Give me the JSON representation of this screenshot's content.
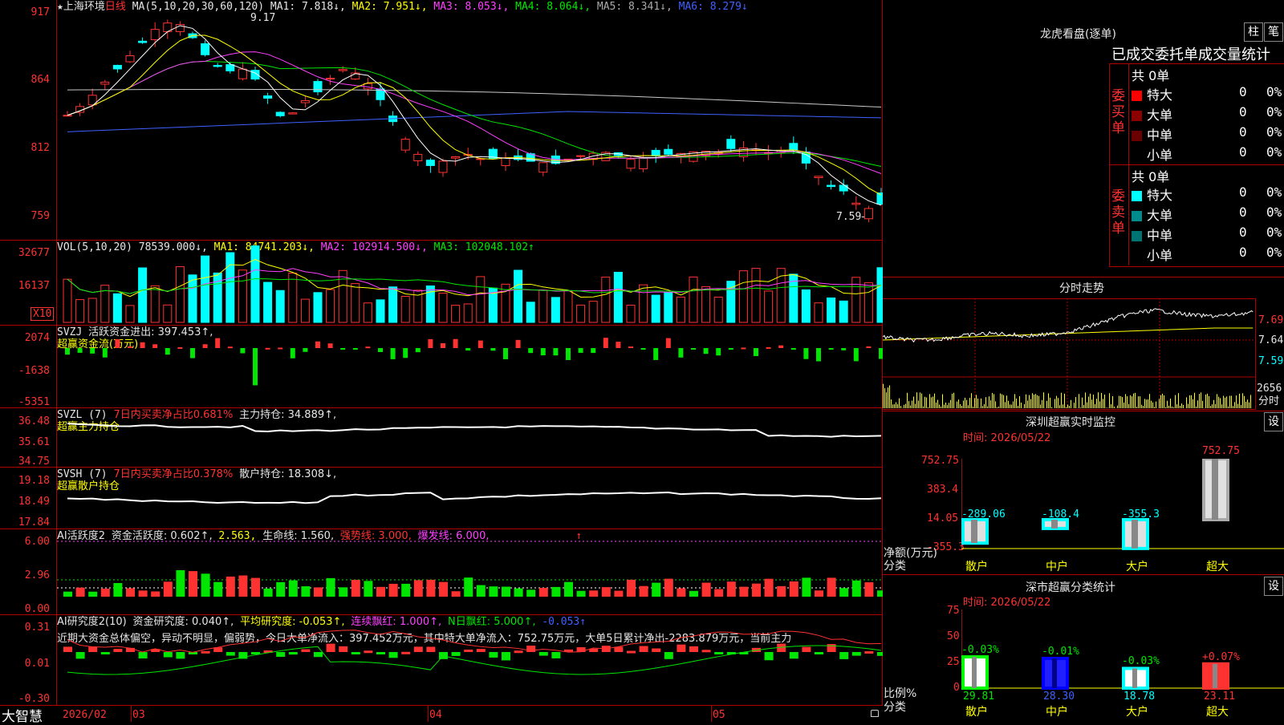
{
  "header": {
    "star": "★",
    "stock_name": "上海环境",
    "period": "日线",
    "ma_params": "MA(5,10,20,30,60,120)",
    "ma1": "MA1: 7.818↓,",
    "ma2": "MA2: 7.951↓,",
    "ma3": "MA3: 8.053↓,",
    "ma4": "MA4: 8.064↓,",
    "ma5": "MA5: 8.341↓,",
    "ma6": "MA6: 8.279↓"
  },
  "price_axis": [
    "917",
    "864",
    "812",
    "759"
  ],
  "price_marks": {
    "high": "9.17",
    "low": "7.59→"
  },
  "vol": {
    "label": "VOL(5,10,20)",
    "val": "78539.000↓,",
    "ma1": "MA1: 84741.203↓,",
    "ma2": "MA2: 102914.500↓,",
    "ma3": "MA3: 102048.102↑",
    "axis": [
      "32677",
      "16137"
    ],
    "unit": "X10"
  },
  "svzj": {
    "label": "SVZJ",
    "line1": "活跃资金进出: 397.453↑,",
    "line2": "超赢资金流(万元)",
    "axis": [
      "2074",
      "-1638",
      "-5351"
    ]
  },
  "svzl": {
    "label": "SVZL (7)",
    "txt1": "7日内买卖净占比0.681%",
    "txt2": "主力持仓: 34.889↑,",
    "line2": "超赢主力持仓",
    "axis": [
      "36.48",
      "35.61",
      "34.75"
    ]
  },
  "svsh": {
    "label": "SVSH (7)",
    "txt1": "7日内买卖净占比0.378%",
    "txt2": "散户持仓: 18.308↓,",
    "line2": "超赢散户持仓",
    "axis": [
      "19.18",
      "18.49",
      "17.84"
    ]
  },
  "ai1": {
    "label": "AI活跃度2",
    "t1": "资金活跃度: 0.602↑,",
    "t2": "2.563,",
    "t3": "生命线: 1.560,",
    "t4": "强势线: 3.000,",
    "t5": "爆发线: 6.000,",
    "t6": "↑",
    "axis": [
      "6.00",
      "2.96",
      "0.00"
    ]
  },
  "ai2": {
    "label": "AI研究度2(10)",
    "t1": "资金研究度: 0.040↑,",
    "t2": "平均研究度: -0.053↑,",
    "t3": "连续飘红: 1.000↑,",
    "t4": "N日飘红: 5.000↑,",
    "t5": "-0.053↑",
    "comment": "近期大资金总体偏空，异动不明显，偏弱势，今日大单净流入：397.452万元，其中特大单净流入：752.75万元，大单5日累计净出-2283.879万元，当前主力",
    "axis": [
      "0.31",
      "0.01",
      "-0.30"
    ]
  },
  "xaxis": {
    "brand": "大智慧",
    "labels": [
      "2026/02",
      "03",
      "04",
      "05"
    ]
  },
  "lhb": {
    "title": "龙虎看盘(逐单)",
    "btn1": "柱",
    "btn2": "笔",
    "subtitle": "已成交委托单成交量统计",
    "buy_side": "委买单",
    "sell_side": "委卖单",
    "buy_total": "共 0单",
    "sell_total": "共 0单",
    "rows": [
      "特大",
      "大单",
      "中单",
      "小单"
    ],
    "zero": "0",
    "pct": "0%"
  },
  "fenshi": {
    "title": "分时走势",
    "axis": [
      "7.69",
      "7.64",
      "7.59"
    ],
    "vol_axis": "2656",
    "vol_label": "分时"
  },
  "monitor": {
    "title": "深圳超赢实时监控",
    "btn": "设",
    "time": "时间: 2026/05/22",
    "axis": [
      "752.75",
      "383.4",
      "14.05",
      "-355.3"
    ],
    "ylabel": "净额(万元)",
    "xlabel": "分类",
    "bars": [
      {
        "name": "散户",
        "value": -289.06,
        "label": "-289.06"
      },
      {
        "name": "中户",
        "value": -108.4,
        "label": "-108.4"
      },
      {
        "name": "大户",
        "value": -355.3,
        "label": "-355.3"
      },
      {
        "name": "超大",
        "value": 752.75,
        "label": "752.75"
      }
    ]
  },
  "stats": {
    "title": "深市超赢分类统计",
    "btn": "设",
    "time": "时间: 2026/05/22",
    "axis": [
      "75",
      "50",
      "25",
      "0"
    ],
    "ylabel": "比例%",
    "xlabel": "分类",
    "bars": [
      {
        "name": "散户",
        "value": 29.81,
        "chg": "-0.03%"
      },
      {
        "name": "中户",
        "value": 28.3,
        "chg": "-0.01%"
      },
      {
        "name": "大户",
        "value": 18.78,
        "chg": "-0.03%"
      },
      {
        "name": "超大",
        "value": 23.11,
        "chg": "+0.07%"
      }
    ]
  },
  "colors": {
    "up": "#ff3232",
    "down": "#00ffff",
    "grid": "#b00000",
    "ma1": "#ffffff",
    "ma2": "#ffff00",
    "ma3": "#ff40ff",
    "ma4": "#00e600",
    "ma5": "#c8c8c8",
    "ma6": "#4060ff"
  }
}
